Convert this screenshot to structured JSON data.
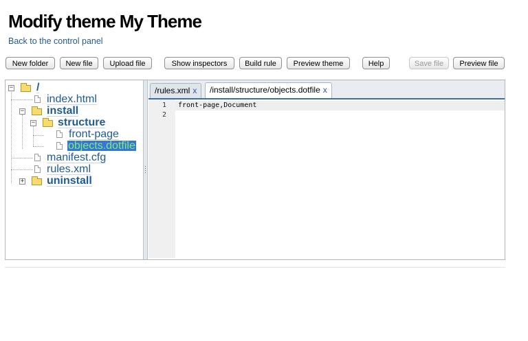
{
  "header": {
    "title": "Modify theme My Theme",
    "back_link": "Back to the control panel"
  },
  "toolbar": {
    "new_folder": "New folder",
    "new_file": "New file",
    "upload_file": "Upload file",
    "show_inspectors": "Show inspectors",
    "build_rule": "Build rule",
    "preview_theme": "Preview theme",
    "help": "Help",
    "save_file": "Save file",
    "preview_file": "Preview file"
  },
  "tree": {
    "root": "/",
    "index_html": "index.html",
    "install": "install",
    "structure": "structure",
    "front_page": "front-page",
    "objects_dotfile": "objects.dotfile",
    "manifest_cfg": "manifest.cfg",
    "rules_xml": "rules.xml",
    "uninstall": "uninstall",
    "expanded_toggle": "−",
    "collapsed_toggle": "+"
  },
  "tabs": [
    {
      "label": "/rules.xml",
      "close": "x",
      "active": false
    },
    {
      "label": "/install/structure/objects.dotfile",
      "close": "x",
      "active": true
    }
  ],
  "editor": {
    "line_numbers": [
      "1",
      "2"
    ],
    "lines": [
      "front-page,Document",
      ""
    ]
  },
  "icons": {
    "folder": "folder-icon",
    "file": "file-icon",
    "expand_collapse": "toggle-icon"
  },
  "colors": {
    "link": "#205c90",
    "selection_bg": "#3875d7",
    "selection_text": "#7cf06a",
    "tab_underline": "#3a6fa3"
  }
}
